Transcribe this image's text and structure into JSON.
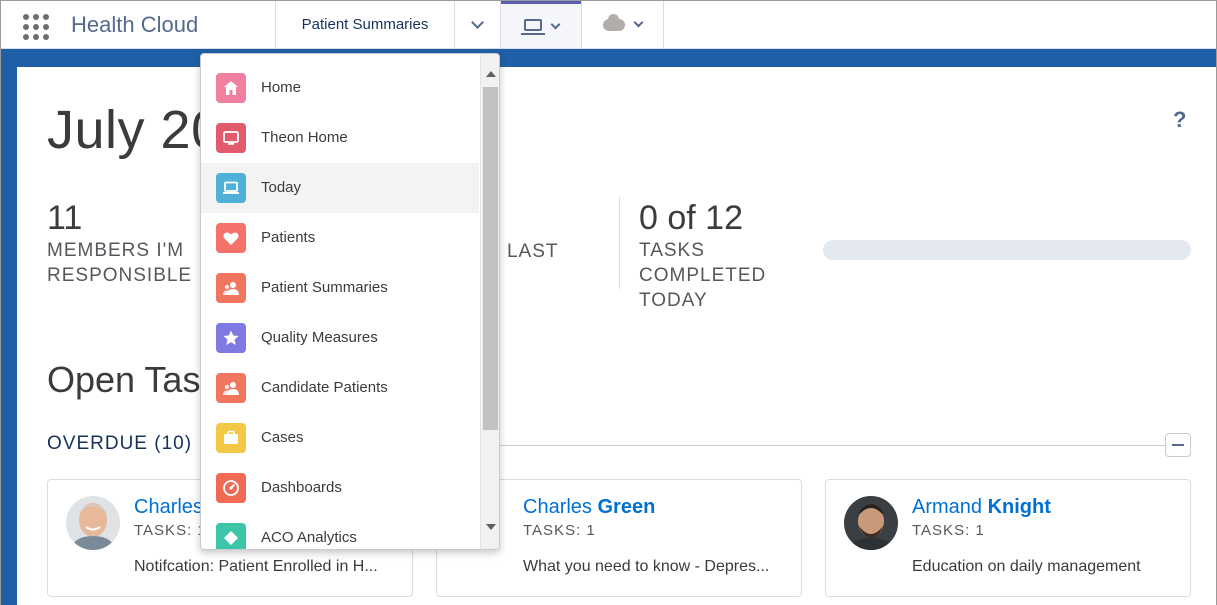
{
  "app": {
    "name": "Health Cloud"
  },
  "nav": {
    "tabs": [
      {
        "label": "Patient Summaries"
      }
    ]
  },
  "page": {
    "title": "July 20",
    "help": "?"
  },
  "stats": [
    {
      "value": "11",
      "label": "MEMBERS I'M RESPONSIBLE"
    },
    {
      "value": "",
      "label": "S LAST"
    },
    {
      "value": "0 of 12",
      "label": "TASKS COMPLETED TODAY",
      "progress_fraction": 0
    }
  ],
  "tasks_section": {
    "title": "Open Tasl",
    "overdue_label": "OVERDUE (10)"
  },
  "cards": [
    {
      "first": "Charles",
      "last": "",
      "tasks": "TASKS: 1",
      "desc": "Notifcation: Patient Enrolled in H..."
    },
    {
      "first": "Charles",
      "last": "Green",
      "tasks": "TASKS: 1",
      "desc": "What you need to know - Depres..."
    },
    {
      "first": "Armand",
      "last": "Knight",
      "tasks": "TASKS: 1",
      "desc": "Education on daily management"
    }
  ],
  "dropdown": {
    "items": [
      {
        "label": "Home",
        "color": "#f07fa0",
        "icon": "home-icon"
      },
      {
        "label": "Theon Home",
        "color": "#e15b6d",
        "icon": "monitor-icon"
      },
      {
        "label": "Today",
        "color": "#4fb0d8",
        "icon": "laptop-icon",
        "active": true
      },
      {
        "label": "Patients",
        "color": "#f4726a",
        "icon": "heart-icon"
      },
      {
        "label": "Patient Summaries",
        "color": "#f2755f",
        "icon": "people-icon"
      },
      {
        "label": "Quality Measures",
        "color": "#7e79e3",
        "icon": "star-icon"
      },
      {
        "label": "Candidate Patients",
        "color": "#f2755f",
        "icon": "people-icon"
      },
      {
        "label": "Cases",
        "color": "#f3c846",
        "icon": "briefcase-icon"
      },
      {
        "label": "Dashboards",
        "color": "#ee6a55",
        "icon": "gauge-icon"
      },
      {
        "label": "ACO Analytics",
        "color": "#3cc5a6",
        "icon": "analytics-icon"
      }
    ]
  }
}
